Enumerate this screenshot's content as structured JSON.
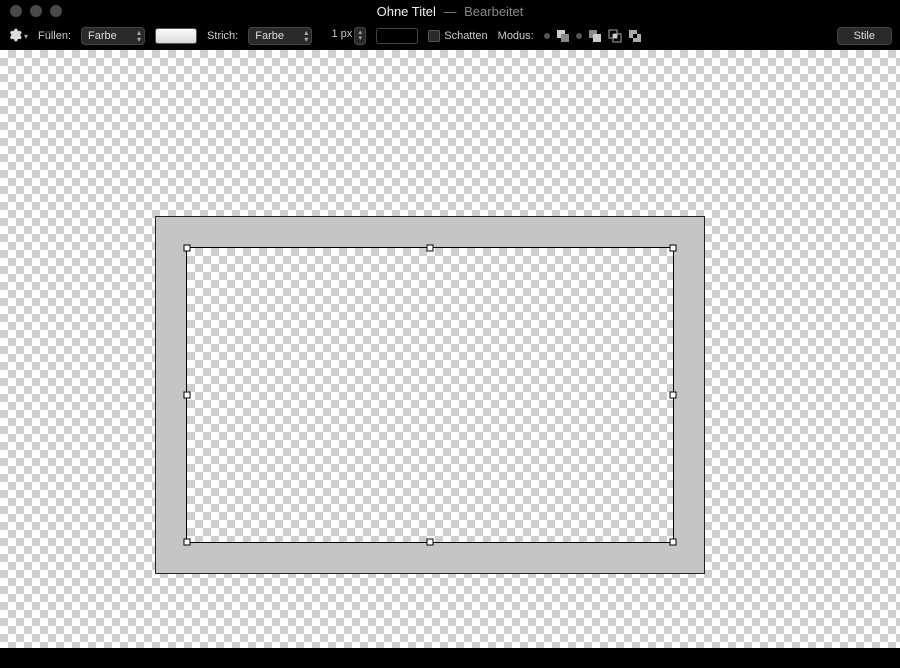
{
  "title": {
    "main": "Ohne Titel",
    "separator": "—",
    "sub": "Bearbeitet"
  },
  "toolbar": {
    "fill_label": "Füllen:",
    "fill_select": "Farbe",
    "stroke_label": "Strich:",
    "stroke_select": "Farbe",
    "stroke_width": "1 px",
    "shadow_label": "Schatten",
    "mode_label": "Modus:",
    "styles_button": "Stile"
  },
  "colors": {
    "fill_swatch": "#e8e8e8",
    "stroke_swatch": "#000000"
  }
}
